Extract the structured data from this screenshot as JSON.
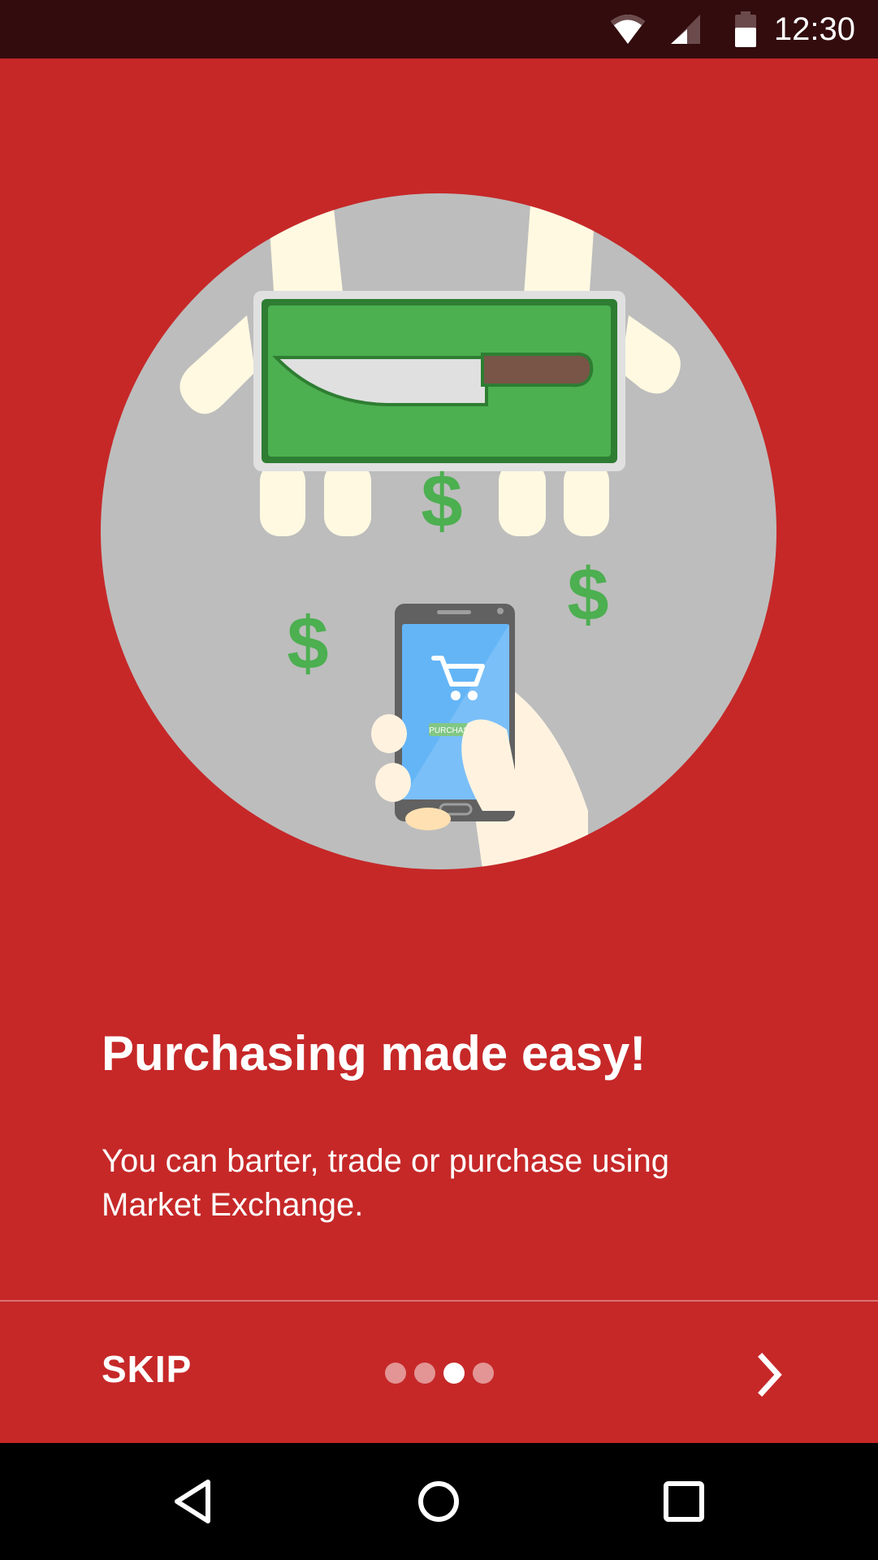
{
  "status_bar": {
    "time": "12:30",
    "icons": [
      "wifi-icon",
      "signal-icon",
      "battery-icon"
    ]
  },
  "illustration": {
    "description_icon": "purchase-illustration",
    "phone_button_text": "PURCHASE",
    "currency_symbol": "$"
  },
  "onboarding": {
    "headline": "Purchasing made easy!",
    "description": "You can barter, trade or purchase using Market Exchange.",
    "skip_label": "SKIP",
    "page_count": 4,
    "active_page": 3,
    "next_icon": "chevron-right-icon"
  },
  "nav_bar": {
    "icons": [
      "back-icon",
      "home-icon",
      "recents-icon"
    ]
  },
  "colors": {
    "background": "#c62828",
    "status_bar": "#330c0e",
    "circle": "#bdbdbd",
    "board": "#4caf50",
    "dollar": "#4caf50",
    "phone_screen": "#64b5f6"
  }
}
